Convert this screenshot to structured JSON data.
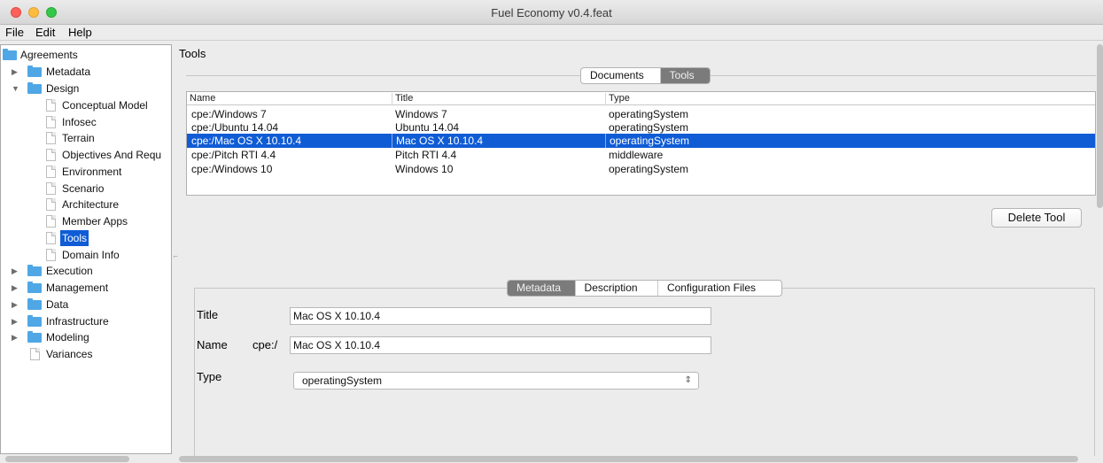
{
  "window": {
    "title": "Fuel Economy v0.4.feat"
  },
  "menu": [
    "File",
    "Edit",
    "Help"
  ],
  "sidebar": {
    "root": "Agreements",
    "items": [
      {
        "label": "Metadata",
        "type": "folder",
        "expanded": false
      },
      {
        "label": "Design",
        "type": "folder",
        "expanded": true
      },
      {
        "label": "Conceptual Model",
        "type": "doc"
      },
      {
        "label": "Infosec",
        "type": "doc"
      },
      {
        "label": "Terrain",
        "type": "doc"
      },
      {
        "label": "Objectives And Requ",
        "type": "doc"
      },
      {
        "label": "Environment",
        "type": "doc"
      },
      {
        "label": "Scenario",
        "type": "doc"
      },
      {
        "label": "Architecture",
        "type": "doc"
      },
      {
        "label": "Member Apps",
        "type": "doc"
      },
      {
        "label": "Tools",
        "type": "doc",
        "selected": true
      },
      {
        "label": "Domain Info",
        "type": "doc"
      },
      {
        "label": "Execution",
        "type": "folder",
        "expanded": false
      },
      {
        "label": "Management",
        "type": "folder",
        "expanded": false
      },
      {
        "label": "Data",
        "type": "folder",
        "expanded": false
      },
      {
        "label": "Infrastructure",
        "type": "folder",
        "expanded": false
      },
      {
        "label": "Modeling",
        "type": "folder",
        "expanded": false
      },
      {
        "label": "Variances",
        "type": "doc"
      }
    ]
  },
  "main": {
    "title": "Tools",
    "top_tabs": [
      {
        "label": "Documents",
        "active": false
      },
      {
        "label": "Tools",
        "active": true
      }
    ],
    "table": {
      "headers": [
        "Name",
        "Title",
        "Type"
      ],
      "rows": [
        {
          "name": "cpe:/Windows 7",
          "title": "Windows 7",
          "type": "operatingSystem",
          "selected": false
        },
        {
          "name": "cpe:/Ubuntu 14.04",
          "title": "Ubuntu 14.04",
          "type": "operatingSystem",
          "selected": false
        },
        {
          "name": "cpe:/Mac OS X 10.10.4",
          "title": "Mac OS X 10.10.4",
          "type": "operatingSystem",
          "selected": true
        },
        {
          "name": "cpe:/Pitch RTI 4.4",
          "title": "Pitch RTI 4.4",
          "type": "middleware",
          "selected": false
        },
        {
          "name": "cpe:/Windows 10",
          "title": "Windows 10",
          "type": "operatingSystem",
          "selected": false
        }
      ]
    },
    "delete_button": "Delete Tool",
    "detail_tabs": [
      {
        "label": "Metadata",
        "active": true
      },
      {
        "label": "Description",
        "active": false
      },
      {
        "label": "Configuration Files",
        "active": false
      }
    ],
    "form": {
      "title_label": "Title",
      "title_value": "Mac OS X 10.10.4",
      "name_label": "Name",
      "name_prefix": "cpe:/",
      "name_value": "Mac OS X 10.10.4",
      "type_label": "Type",
      "type_value": "operatingSystem"
    }
  },
  "colors": {
    "selection": "#0f5cd5",
    "folder": "#4fa7e5",
    "active_tab": "#7b7b7b"
  }
}
